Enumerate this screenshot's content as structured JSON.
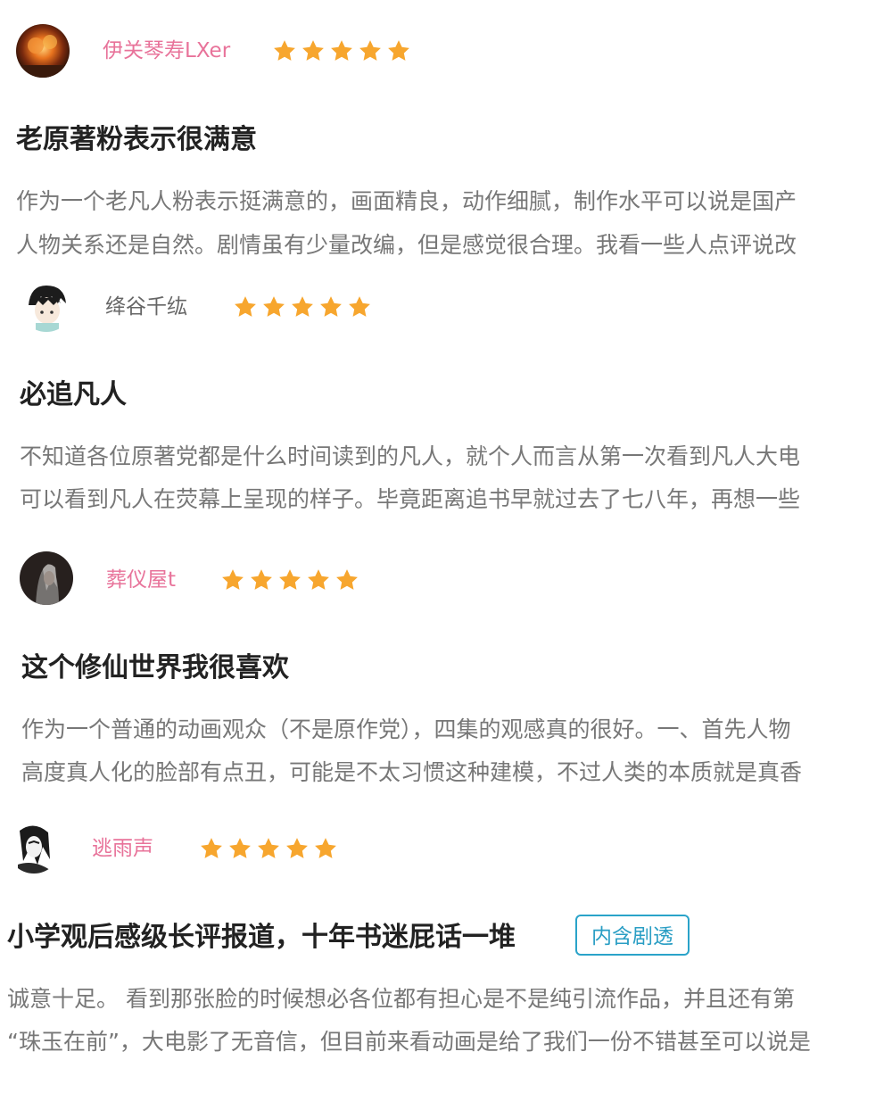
{
  "colors": {
    "star": "#f7a62e",
    "username_pink": "#e8739a",
    "username_gray": "#666666",
    "title": "#222222",
    "body": "#777777",
    "spoiler": "#2a9ec4"
  },
  "reviews": [
    {
      "username": "伊关琴寿LXer",
      "rating": 5,
      "title": "老原著粉表示很满意",
      "lines": [
        "作为一个老凡人粉表示挺满意的，画面精良，动作细腻，制作水平可以说是国产",
        "人物关系还是自然。剧情虽有少量改编，但是感觉很合理。我看一些人点评说改"
      ]
    },
    {
      "username": "绛谷千纮",
      "rating": 5,
      "title": "必追凡人",
      "lines": [
        "不知道各位原著党都是什么时间读到的凡人，就个人而言从第一次看到凡人大电",
        "可以看到凡人在荧幕上呈现的样子。毕竟距离追书早就过去了七八年，再想一些"
      ]
    },
    {
      "username": "葬仪屋t",
      "rating": 5,
      "title": "这个修仙世界我很喜欢",
      "lines": [
        "作为一个普通的动画观众（不是原作党），四集的观感真的很好。一、首先人物",
        "高度真人化的脸部有点丑，可能是不太习惯这种建模，不过人类的本质就是真香"
      ]
    },
    {
      "username": "逃雨声",
      "rating": 5,
      "title": "小学观后感级长评报道，十年书迷屁话一堆",
      "spoiler_tag": "内含剧透",
      "lines": [
        "诚意十足。 看到那张脸的时候想必各位都有担心是不是纯引流作品，并且还有第",
        "“珠玉在前”，大电影了无音信，但目前来看动画是给了我们一份不错甚至可以说是"
      ]
    }
  ]
}
